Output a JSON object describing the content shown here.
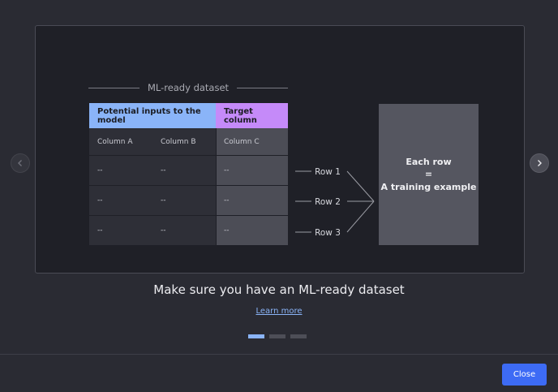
{
  "carousel": {
    "prev_icon": "chevron-left-icon",
    "next_icon": "chevron-right-icon",
    "slide_count": 3,
    "active_slide": 1
  },
  "diagram": {
    "title": "ML-ready dataset",
    "inputs_header": "Potential inputs to the model",
    "target_header": "Target column",
    "columns": [
      "Column A",
      "Column B",
      "Column C"
    ],
    "rows": [
      [
        "--",
        "--",
        "--"
      ],
      [
        "--",
        "--",
        "--"
      ],
      [
        "--",
        "--",
        "--"
      ]
    ],
    "row_labels": [
      "Row 1",
      "Row 2",
      "Row 3"
    ],
    "box_lines": [
      "Each row",
      "=",
      "A training example"
    ],
    "colors": {
      "inputs_header": "#8ab4f8",
      "target_header": "#c58af9",
      "target_cells": "#4c4d56",
      "input_cells": "#2e2f37",
      "box": "#555660"
    }
  },
  "caption": "Make sure you have an ML-ready dataset",
  "learn_more": "Learn more",
  "footer": {
    "close_label": "Close",
    "accent": "#3d6bf5"
  }
}
